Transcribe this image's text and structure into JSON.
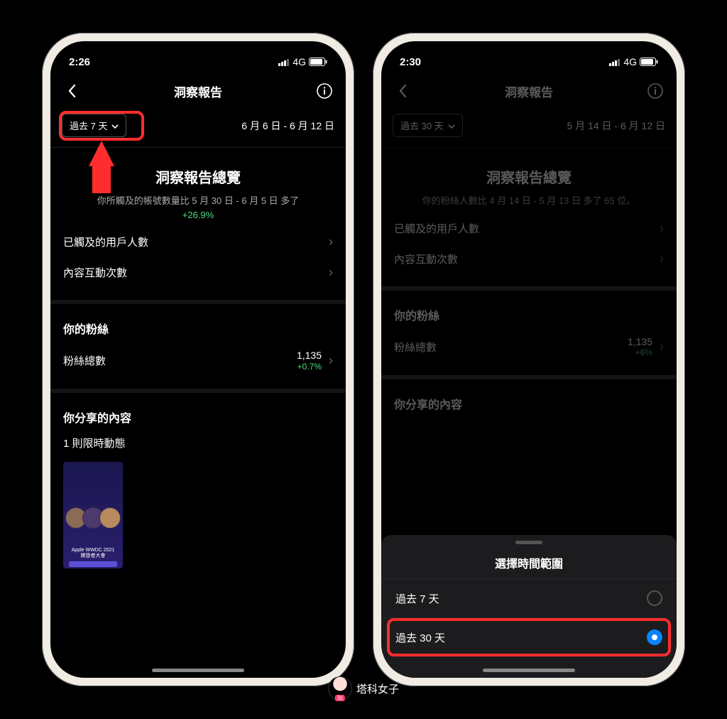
{
  "phone1": {
    "status": {
      "time": "2:26",
      "network": "4G"
    },
    "nav": {
      "title": "洞察報告"
    },
    "range": {
      "chip": "過去 7 天",
      "dates": "6 月 6 日 - 6 月 12 日"
    },
    "overview": {
      "title": "洞察報告總覽",
      "sub_prefix": "你所觸及的帳號數量比 5 月 30 日 - 6 月 5 日 多了",
      "pct": "+26.9%"
    },
    "metrics": {
      "reach_label": "已觸及的用戶人數",
      "interactions_label": "內容互動次數"
    },
    "fans": {
      "section": "你的粉絲",
      "total_label": "粉絲總數",
      "total_value": "1,135",
      "delta": "+0.7%"
    },
    "shared": {
      "section": "你分享的內容",
      "count": "1 則限時動態",
      "thumb_caption": "Apple WWDC 2021\n開發者大會"
    }
  },
  "phone2": {
    "status": {
      "time": "2:30",
      "network": "4G"
    },
    "nav": {
      "title": "洞察報告"
    },
    "range": {
      "chip": "過去 30 天",
      "dates": "5 月 14 日 - 6 月 12 日"
    },
    "overview": {
      "title": "洞察報告總覽",
      "sub_full": "你的粉絲人數比 4 月 14 日 - 5 月 13 日 多了 65 位。"
    },
    "metrics": {
      "reach_label": "已觸及的用戶人數",
      "interactions_label": "內容互動次數"
    },
    "fans": {
      "section": "你的粉絲",
      "total_label": "粉絲總數",
      "total_value": "1,135",
      "delta": "+6%"
    },
    "shared": {
      "section": "你分享的內容"
    },
    "sheet": {
      "title": "選擇時間範圍",
      "opt7": "過去 7 天",
      "opt30": "過去 30 天"
    }
  },
  "watermark": "塔科女子"
}
